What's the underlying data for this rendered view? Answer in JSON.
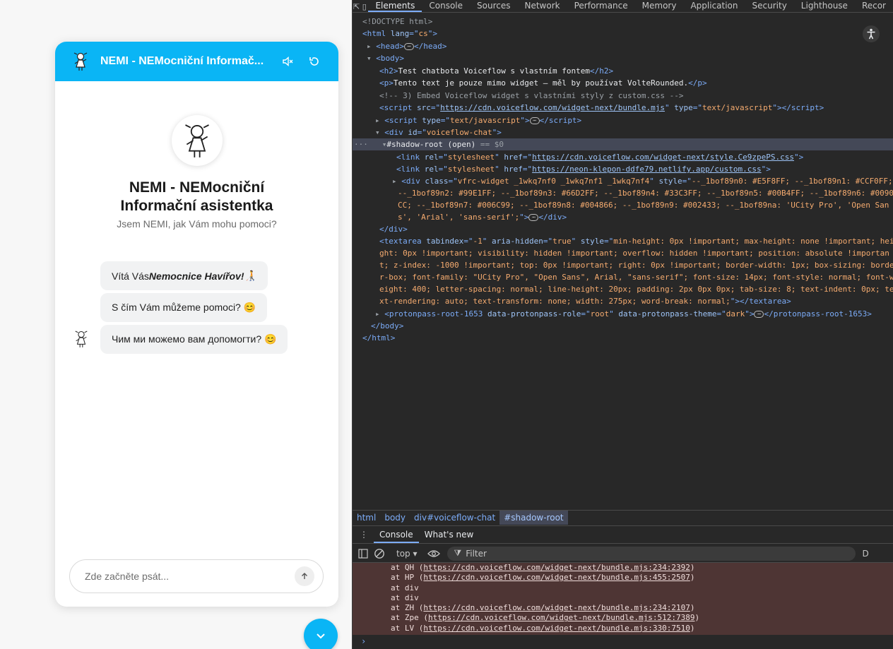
{
  "widget": {
    "title": "NEMI - NEMocniční Informač...",
    "assistant_name": "NEMI - NEMocniční Informační asistentka",
    "assistant_desc": "Jsem NEMI, jak Vám mohu pomoci?",
    "messages": [
      {
        "pre": "Vítá Vás ",
        "bold": "Nemocnice Havířov!",
        "post": " 🧑‍🦯"
      },
      {
        "pre": "S čím Vám můžeme pomoci? 😊",
        "bold": "",
        "post": ""
      },
      {
        "pre": "Чим ми можемо вам допомогти? 😊",
        "bold": "",
        "post": ""
      }
    ],
    "input_placeholder": "Zde začněte psát...",
    "colors": {
      "accent": "#0ab5f5"
    }
  },
  "devtools": {
    "tabs": [
      "Elements",
      "Console",
      "Sources",
      "Network",
      "Performance",
      "Memory",
      "Application",
      "Security",
      "Lighthouse",
      "Recor"
    ],
    "active_tab": "Elements",
    "breadcrumb": [
      "html",
      "body",
      "div#voiceflow-chat",
      "#shadow-root"
    ],
    "drawer_tabs": [
      "Console",
      "What's new"
    ],
    "console_context": "top ▾",
    "filter_placeholder": "Filter",
    "log_lines": [
      {
        "pre": "at QH (",
        "link": "https://cdn.voiceflow.com/widget-next/bundle.mjs:234:2392",
        "post": ")"
      },
      {
        "pre": "at HP (",
        "link": "https://cdn.voiceflow.com/widget-next/bundle.mjs:455:2507",
        "post": ")"
      },
      {
        "pre": "at div",
        "link": "",
        "post": ""
      },
      {
        "pre": "at div",
        "link": "",
        "post": ""
      },
      {
        "pre": "at ZH (",
        "link": "https://cdn.voiceflow.com/widget-next/bundle.mjs:234:2107",
        "post": ")"
      },
      {
        "pre": "at Zpe (",
        "link": "https://cdn.voiceflow.com/widget-next/bundle.mjs:512:7389",
        "post": ")"
      },
      {
        "pre": "at LV (",
        "link": "https://cdn.voiceflow.com/widget-next/bundle.mjs:330:7510",
        "post": ")"
      }
    ],
    "tree": {
      "doctype": "<!DOCTYPE html>",
      "html_lang": "cs",
      "h2_text": "Test chatbota Voiceflow s vlastním fontem",
      "p_text": "Tento text je pouze mimo widget – měl by používat VolteRounded.",
      "comment": "<!-- 3) Embed Voiceflow widget s vlastními styly z custom.css -->",
      "script_src": "https://cdn.voiceflow.com/widget-next/bundle.mjs",
      "script_type": "text/javascript",
      "div_id": "voiceflow-chat",
      "shadow_root": "#shadow-root (open)",
      "shadow_eq": "== $0",
      "link1_href": "https://cdn.voiceflow.com/widget-next/style.Ce9zpePS.css",
      "link2_href": "https://neon-klepon-ddfe79.netlify.app/custom.css",
      "vfrc_class": "vfrc-widget _1wkq7nf0 _1wkq7nf1 _1wkq7nf4",
      "vfrc_style": [
        "--_1bof89n0: #E5F8FF; --_1bof89n1: #CCF0FF;",
        "--_1bof89n2: #99E1FF; --_1bof89n3: #66D2FF; --_1bof89n4: #33C3FF; --_1bof89n5: #00B4FF; --_1bof89n6: #0090",
        "CC; --_1bof89n7: #006C99; --_1bof89n8: #004866; --_1bof89n9: #002433; --_1bof89na: 'UCity Pro', 'Open San",
        "s', 'Arial', 'sans-serif';"
      ],
      "textarea_style": [
        "min-height: 0px !important; max-height: none !important; hei",
        "ght: 0px !important; visibility: hidden !important; overflow: hidden !important; position: absolute !importan",
        "t; z-index: -1000 !important; top: 0px !important; right: 0px !important; border-width: 1px; box-sizing: borde",
        "r-box; font-family: \"UCity Pro\", \"Open Sans\", Arial, \"sans-serif\"; font-size: 14px; font-style: normal; font-w",
        "eight: 400; letter-spacing: normal; line-height: 20px; padding: 2px 0px 0px; tab-size: 8; text-indent: 0px; te",
        "xt-rendering: auto; text-transform: none; width: 275px; word-break: normal;"
      ],
      "protonpass": "protonpass-root-1653",
      "protonpass_role": "root",
      "protonpass_theme": "dark"
    }
  }
}
